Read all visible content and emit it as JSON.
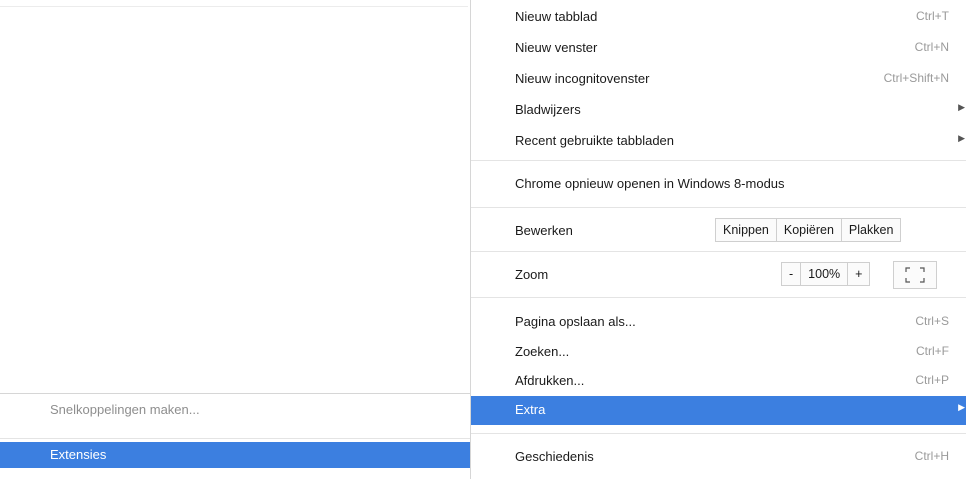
{
  "menu": {
    "new_tab": {
      "label": "Nieuw tabblad",
      "shortcut": "Ctrl+T"
    },
    "new_window": {
      "label": "Nieuw venster",
      "shortcut": "Ctrl+N"
    },
    "new_incognito": {
      "label": "Nieuw incognitovenster",
      "shortcut": "Ctrl+Shift+N"
    },
    "bookmarks": {
      "label": "Bladwijzers"
    },
    "recent_tabs": {
      "label": "Recent gebruikte tabbladen"
    },
    "relaunch_win8": {
      "label": "Chrome opnieuw openen in Windows 8-modus"
    },
    "edit": {
      "label": "Bewerken",
      "cut": "Knippen",
      "copy": "Kopiëren",
      "paste": "Plakken"
    },
    "zoom": {
      "label": "Zoom",
      "minus": "-",
      "value": "100%",
      "plus": "+"
    },
    "save_page": {
      "label": "Pagina opslaan als...",
      "shortcut": "Ctrl+S"
    },
    "find": {
      "label": "Zoeken...",
      "shortcut": "Ctrl+F"
    },
    "print": {
      "label": "Afdrukken...",
      "shortcut": "Ctrl+P"
    },
    "more_tools": {
      "label": "Extra"
    },
    "history": {
      "label": "Geschiedenis",
      "shortcut": "Ctrl+H"
    }
  },
  "submenu": {
    "create_shortcuts": {
      "label": "Snelkoppelingen maken..."
    },
    "extensions": {
      "label": "Extensies"
    }
  },
  "colors": {
    "highlight": "#3c7fe0"
  }
}
